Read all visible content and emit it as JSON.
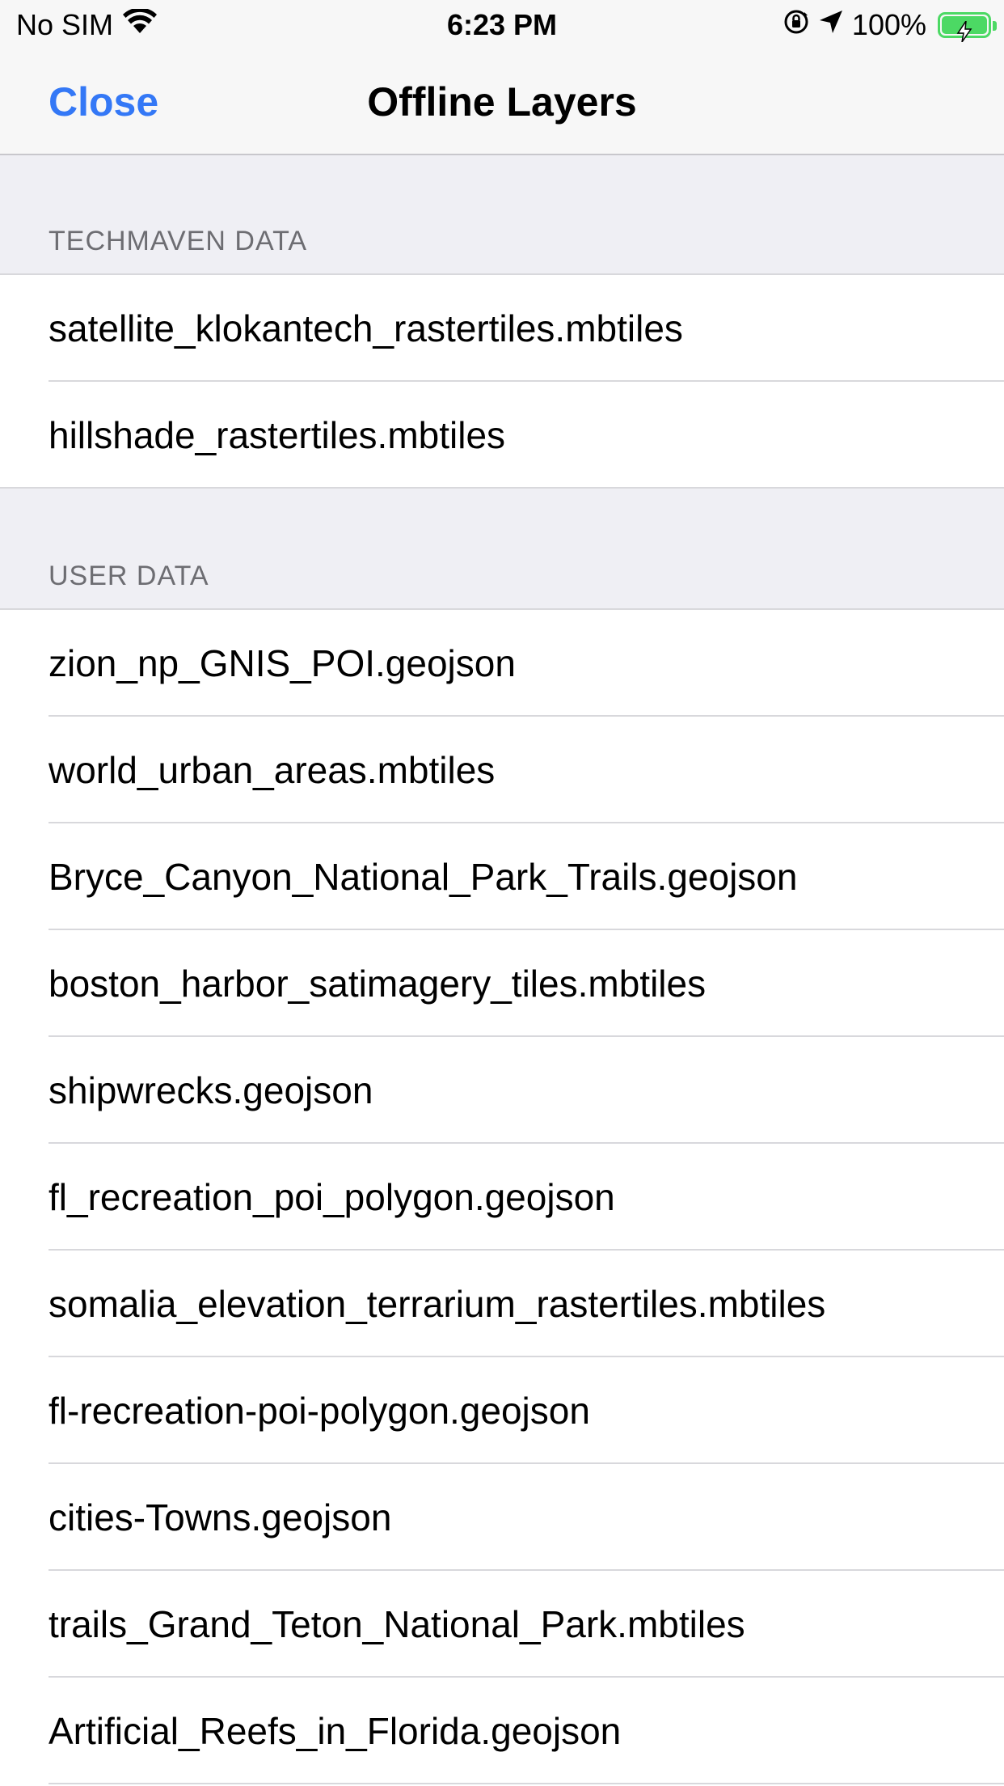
{
  "status_bar": {
    "carrier": "No SIM",
    "time": "6:23 PM",
    "battery_percent": "100%",
    "battery_color": "#4cd964"
  },
  "nav": {
    "close_label": "Close",
    "title": "Offline Layers",
    "accent_color": "#3478f6"
  },
  "sections": [
    {
      "header": "TECHMAVEN DATA",
      "items": [
        "satellite_klokantech_rastertiles.mbtiles",
        "hillshade_rastertiles.mbtiles"
      ]
    },
    {
      "header": "USER DATA",
      "items": [
        "zion_np_GNIS_POI.geojson",
        "world_urban_areas.mbtiles",
        "Bryce_Canyon_National_Park_Trails.geojson",
        "boston_harbor_satimagery_tiles.mbtiles",
        "shipwrecks.geojson",
        "fl_recreation_poi_polygon.geojson",
        "somalia_elevation_terrarium_rastertiles.mbtiles",
        "fl-recreation-poi-polygon.geojson",
        "cities-Towns.geojson",
        "trails_Grand_Teton_National_Park.mbtiles",
        "Artificial_Reefs_in_Florida.geojson"
      ]
    }
  ]
}
